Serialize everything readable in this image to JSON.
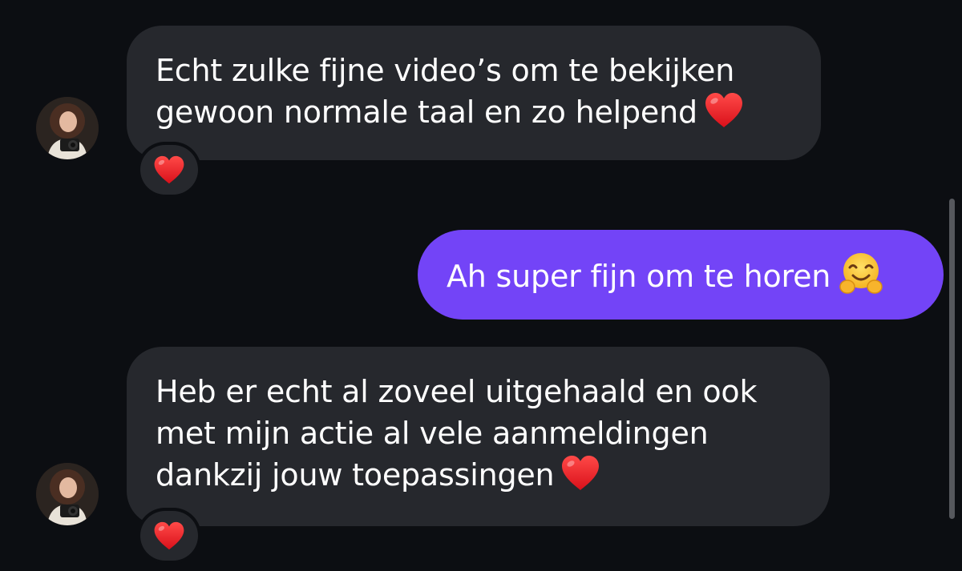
{
  "messages": [
    {
      "direction": "incoming",
      "lines": [
        "Echt zulke fijne video’s om te bekijken",
        "gewoon normale taal en zo helpend"
      ],
      "trailing_emoji": "red-heart",
      "reaction": "red-heart"
    },
    {
      "direction": "outgoing",
      "text": "Ah super fijn om te horen",
      "trailing_emoji": "hugging-face"
    },
    {
      "direction": "incoming",
      "lines": [
        "Heb er echt al zoveel uitgehaald en ook",
        "met mijn actie al vele aanmeldingen",
        "dankzij jouw toepassingen"
      ],
      "trailing_emoji": "red-heart",
      "reaction": "red-heart"
    }
  ],
  "colors": {
    "background": "#0c0e12",
    "incoming_bubble": "#26282d",
    "outgoing_bubble": "#7344f7",
    "heart": "#e8262a"
  }
}
